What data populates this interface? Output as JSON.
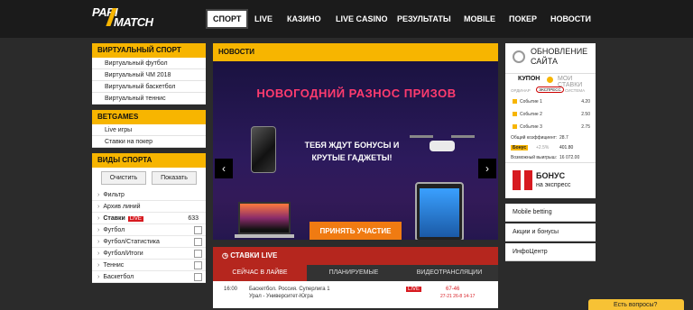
{
  "nav": {
    "logo_top": "PARI",
    "logo_bottom": "MATCH",
    "items": [
      "СПОРТ",
      "LIVE",
      "КАЗИНО",
      "LIVE CASINO",
      "РЕЗУЛЬТАТЫ",
      "MOBILE",
      "ПОКЕР",
      "НОВОСТИ"
    ]
  },
  "left": {
    "virtual_title": "ВИРТУАЛЬНЫЙ СПОРТ",
    "virtual_items": [
      "Виртуальный футбол",
      "Виртуальный ЧМ 2018",
      "Виртуальный баскетбол",
      "Виртуальный теннис"
    ],
    "betgames_title": "BETGAMES",
    "betgames_items": [
      "Live игры",
      "Ставки на покер"
    ],
    "sports_title": "ВИДЫ СПОРТА",
    "clear_btn": "Очистить",
    "show_btn": "Показать",
    "sports_items": [
      {
        "label": "Фильтр"
      },
      {
        "label": "Архив линий"
      },
      {
        "label": "Ставки",
        "badge": "LIVE",
        "count": "633"
      },
      {
        "label": "Футбол"
      },
      {
        "label": "Футбол/Статистика"
      },
      {
        "label": "Футбол/Итоги"
      },
      {
        "label": "Теннис"
      },
      {
        "label": "Баскетбол"
      }
    ]
  },
  "center": {
    "news_title": "НОВОСТИ",
    "banner_title": "НОВОГОДНИЙ РАЗНОС ПРИЗОВ",
    "banner_sub": "ТЕБЯ ЖДУТ БОНУСЫ И КРУТЫЕ ГАДЖЕТЫ!",
    "banner_cta": "ПРИНЯТЬ УЧАСТИЕ",
    "live_title": "СТАВКИ LIVE",
    "live_tabs": [
      "СЕЙЧАС В ЛАЙВЕ",
      "ПЛАНИРУЕМЫЕ",
      "ВИДЕОТРАНСЛЯЦИИ"
    ],
    "live_row": {
      "time": "16:00",
      "event": "Баскетбол. Россия. Суперлига 1",
      "teams": "Урал - Университет-Югра",
      "badge": "LIVE",
      "score": "67-46",
      "sub": "27-21 26-8 14-17"
    }
  },
  "right": {
    "update_title": "ОБНОВЛЕНИЕ САЙТА",
    "coupon_tab": "КУПОН",
    "my_bets_tab": "МОИ СТАВКИ",
    "types": [
      "ОРДИНАР",
      "ЭКСПРЕСС",
      "СИСТЕМА"
    ],
    "events": [
      {
        "name": "Событие 1",
        "odds": "4.20"
      },
      {
        "name": "Событие 2",
        "odds": "2.50"
      },
      {
        "name": "Событие 3",
        "odds": "2.75"
      }
    ],
    "total_label": "Общий коэффициент:",
    "total_value": "28.7",
    "bonus_label": "Бонус",
    "bonus_pct": "+2.5%",
    "bonus_value": "401.80",
    "win_label": "Возможный выигрыш:",
    "win_value": "16 072.00",
    "promo_title": "БОНУС",
    "promo_sub": "на экспресс",
    "links": [
      "Mobile betting",
      "Акции и бонусы",
      "ИнфоЦентр"
    ],
    "help": "Есть вопросы?"
  },
  "colors": {
    "accent": "#f7b500",
    "live_red": "#b5261e",
    "cta": "#f07b12"
  }
}
